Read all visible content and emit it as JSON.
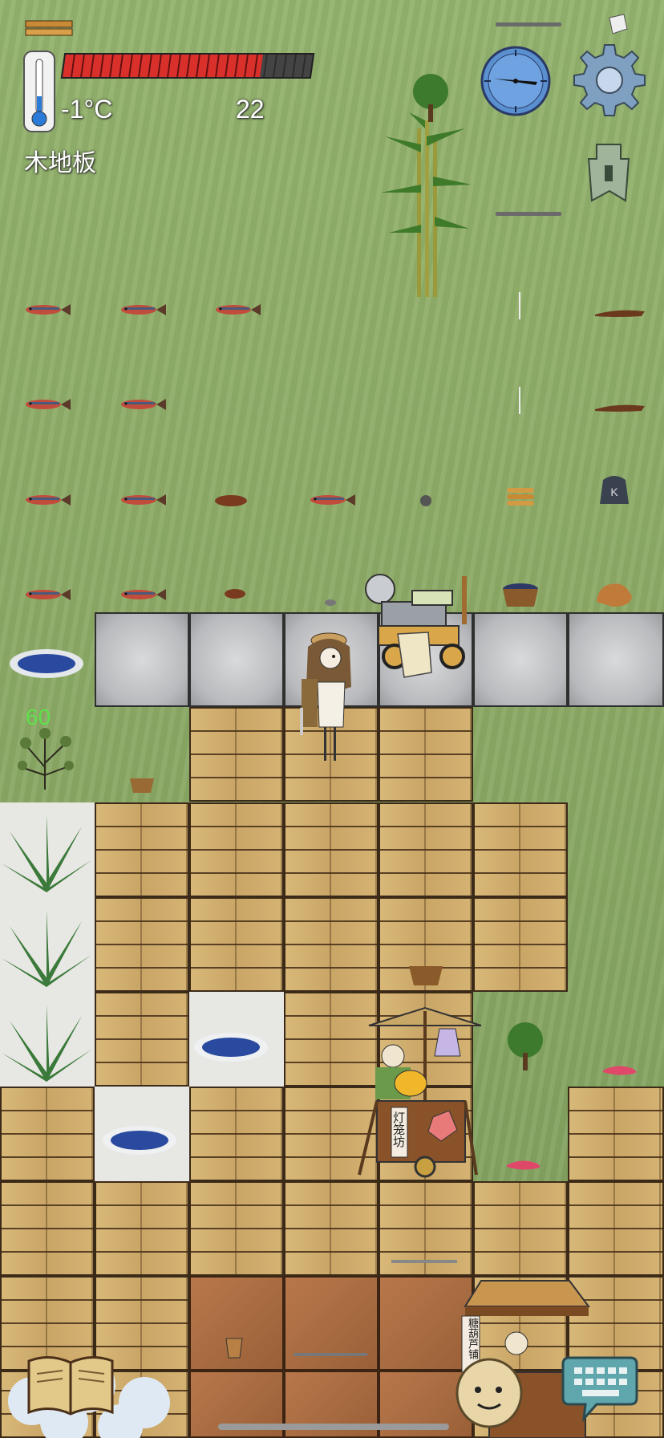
{
  "hud": {
    "temperature": "-1°C",
    "counter": "22",
    "location_label": "木地板",
    "health_fill": 0.8,
    "health_color": "#d9302c",
    "plant_stat": "60"
  },
  "icons": {
    "thermometer": "thermometer-icon",
    "compass": "compass-icon",
    "settings": "gear-icon",
    "coin": "ancient-coin-icon",
    "recipe_book": "book-icon",
    "keyboard": "keyboard-chat-icon",
    "emote": "potato-face-icon"
  },
  "signs": {
    "lantern_shop": "灯笼坊",
    "snack_stall": "糖葫芦铺"
  }
}
